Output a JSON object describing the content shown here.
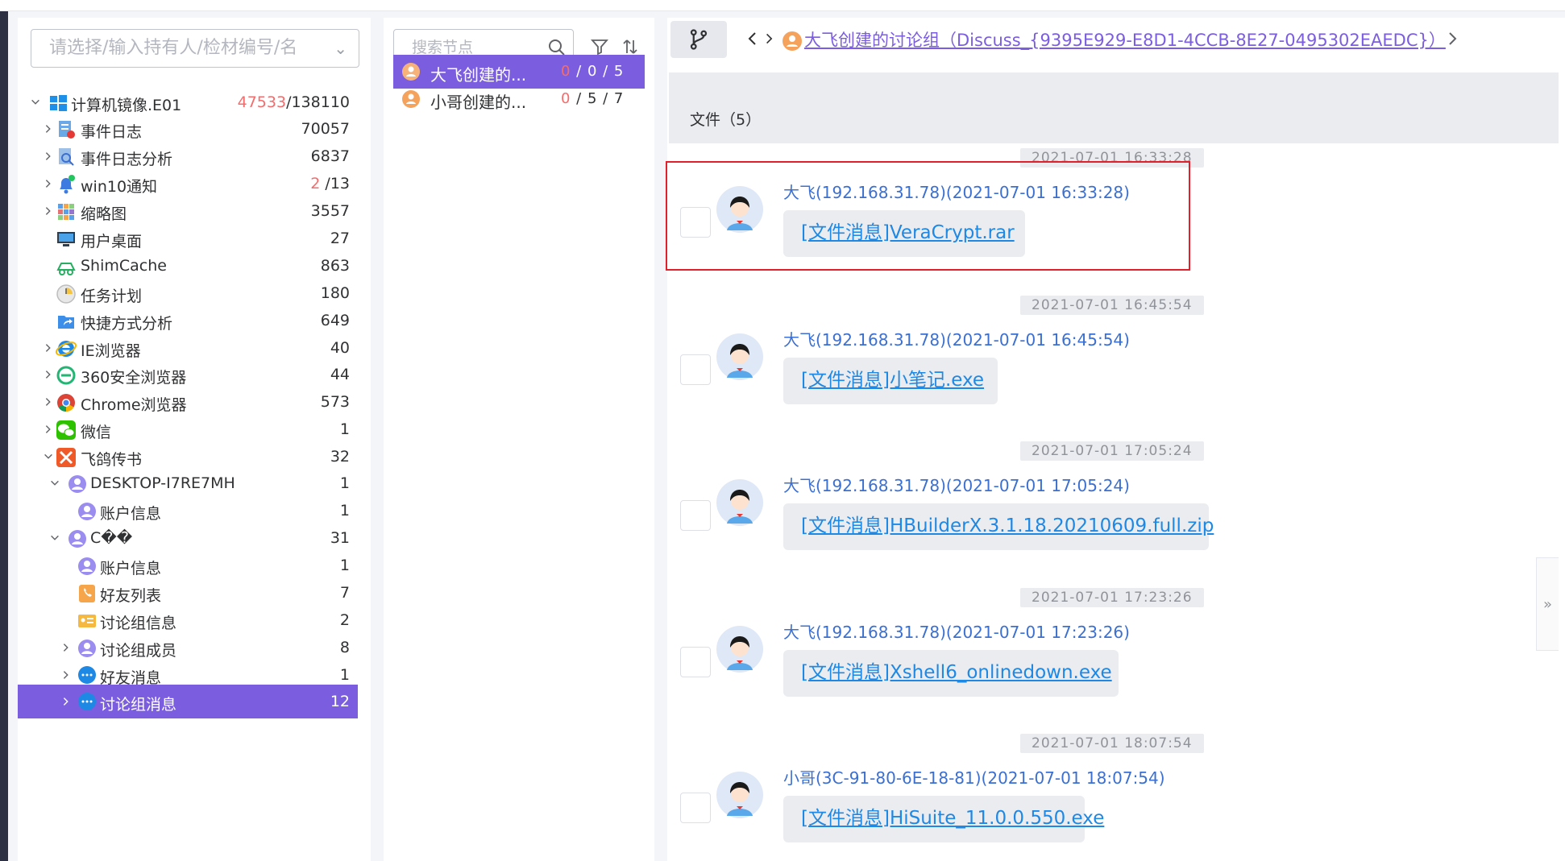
{
  "left": {
    "select_placeholder": "请选择/输入持有人/检材编号/名",
    "tree": [
      {
        "label": "计算机镜像.E01",
        "count_red": "47533",
        "count": "/138110",
        "icon": "windows-icon",
        "arrow": "down",
        "level": 0
      },
      {
        "label": "事件日志",
        "count": "70057",
        "icon": "event-log-icon",
        "arrow": "right",
        "level": 1
      },
      {
        "label": "事件日志分析",
        "count": "6837",
        "icon": "log-analysis-icon",
        "arrow": "right",
        "level": 1
      },
      {
        "label": "win10通知",
        "count_red": "2",
        "count": " /13",
        "icon": "bell-icon",
        "arrow": "right",
        "level": 1
      },
      {
        "label": "缩略图",
        "count": "3557",
        "icon": "thumbnail-icon",
        "arrow": "right",
        "level": 1
      },
      {
        "label": "用户桌面",
        "count": "27",
        "icon": "desktop-icon",
        "arrow": "",
        "level": 1
      },
      {
        "label": "ShimCache",
        "count": "863",
        "icon": "shimcache-icon",
        "arrow": "",
        "level": 1
      },
      {
        "label": "任务计划",
        "count": "180",
        "icon": "clock-icon",
        "arrow": "",
        "level": 1
      },
      {
        "label": "快捷方式分析",
        "count": "649",
        "icon": "shortcut-icon",
        "arrow": "",
        "level": 1
      },
      {
        "label": "IE浏览器",
        "count": "40",
        "icon": "ie-icon",
        "arrow": "right",
        "level": 1
      },
      {
        "label": "360安全浏览器",
        "count": "44",
        "icon": "browser-360-icon",
        "arrow": "right",
        "level": 1
      },
      {
        "label": "Chrome浏览器",
        "count": "573",
        "icon": "chrome-icon",
        "arrow": "right",
        "level": 1
      },
      {
        "label": "微信",
        "count": "1",
        "icon": "wechat-icon",
        "arrow": "right",
        "level": 1
      },
      {
        "label": "飞鸽传书",
        "count": "32",
        "icon": "feige-icon",
        "arrow": "down",
        "level": 1
      },
      {
        "label": "DESKTOP-I7RE7MH",
        "count": "1",
        "icon": "user-icon",
        "arrow": "down",
        "level": 2
      },
      {
        "label": "账户信息",
        "count": "1",
        "icon": "user-icon",
        "arrow": "",
        "level": 3
      },
      {
        "label": "C��",
        "count": "31",
        "icon": "user-icon",
        "arrow": "down",
        "level": 2
      },
      {
        "label": "账户信息",
        "count": "1",
        "icon": "user-icon",
        "arrow": "",
        "level": 3
      },
      {
        "label": "好友列表",
        "count": "7",
        "icon": "contacts-icon",
        "arrow": "",
        "level": 3
      },
      {
        "label": "讨论组信息",
        "count": "2",
        "icon": "group-info-icon",
        "arrow": "",
        "level": 3
      },
      {
        "label": "讨论组成员",
        "count": "8",
        "icon": "user-icon",
        "arrow": "right",
        "level": 3
      },
      {
        "label": "好友消息",
        "count": "1",
        "icon": "chat-bubble-icon",
        "arrow": "right",
        "level": 3
      },
      {
        "label": "讨论组消息",
        "count": "12",
        "icon": "chat-bubble-icon",
        "arrow": "right",
        "level": 3,
        "selected": true
      }
    ]
  },
  "middle": {
    "search_placeholder": "搜索节点",
    "items": [
      {
        "name": "大飞创建的...",
        "c1": "0",
        "c2": " / 0 / 5",
        "selected": true
      },
      {
        "name": "小哥创建的...",
        "c1": "0",
        "c2": " / 5 / 7",
        "selected": false
      }
    ]
  },
  "right": {
    "path_title": "大飞创建的讨论组（Discuss_{9395E929-E8D1-4CCB-8E27-0495302EAEDC}）",
    "files_title": "文件（5）",
    "messages": [
      {
        "time": "2021-07-01 16:33:28",
        "sender": "大飞(192.168.31.78)(2021-07-01 16:33:28)",
        "content": "[文件消息]VeraCrypt.rar"
      },
      {
        "time": "2021-07-01 16:45:54",
        "sender": "大飞(192.168.31.78)(2021-07-01 16:45:54)",
        "content": "[文件消息]小笔记.exe"
      },
      {
        "time": "2021-07-01 17:05:24",
        "sender": "大飞(192.168.31.78)(2021-07-01 17:05:24)",
        "content": "[文件消息]HBuilderX.3.1.18.20210609.full.zip"
      },
      {
        "time": "2021-07-01 17:23:26",
        "sender": "大飞(192.168.31.78)(2021-07-01 17:23:26)",
        "content": "[文件消息]Xshell6_onlinedown.exe"
      },
      {
        "time": "2021-07-01 18:07:54",
        "sender": "小哥(3C-91-80-6E-18-81)(2021-07-01 18:07:54)",
        "content": "[文件消息]HiSuite_11.0.0.550.exe"
      }
    ],
    "side_handle": "»"
  },
  "colors": {
    "accent": "#7b5ee0",
    "red": "#f56c6c",
    "link": "#1e88e5",
    "sender": "#3b6fd0",
    "highlight": "#e0202a"
  }
}
